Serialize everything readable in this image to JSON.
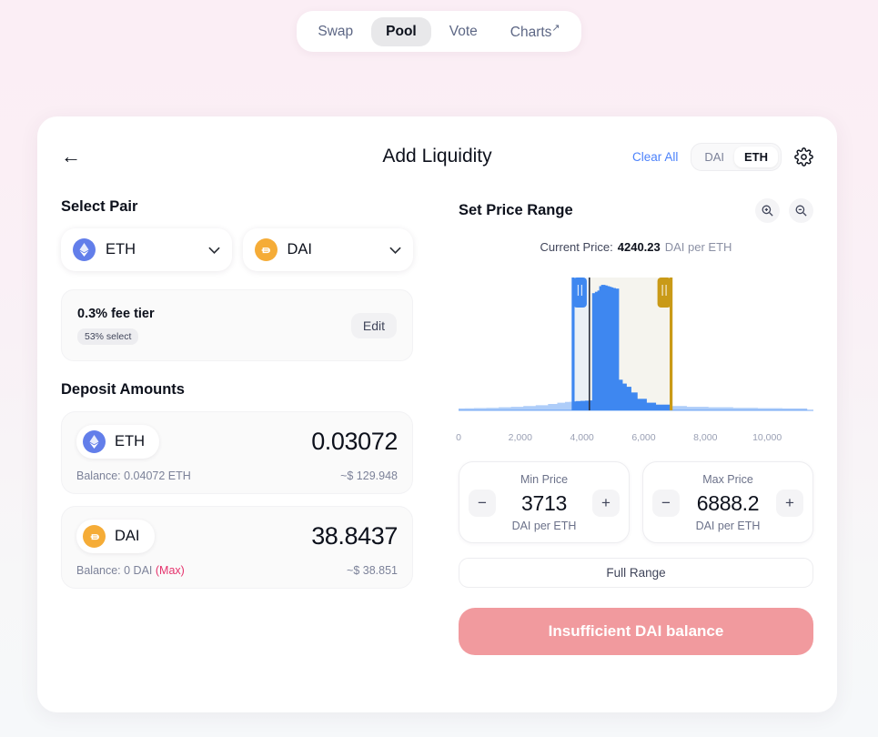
{
  "nav": {
    "items": [
      {
        "label": "Swap",
        "active": false,
        "external": false
      },
      {
        "label": "Pool",
        "active": true,
        "external": false
      },
      {
        "label": "Vote",
        "active": false,
        "external": false
      },
      {
        "label": "Charts",
        "active": false,
        "external": true
      }
    ],
    "external_marker": "↗"
  },
  "header": {
    "back_icon": "←",
    "title": "Add Liquidity",
    "clear_all": "Clear All",
    "toggle": {
      "left": "DAI",
      "right": "ETH",
      "selected": "ETH"
    },
    "settings_icon": "gear-icon"
  },
  "select_pair": {
    "title": "Select Pair",
    "tokens": [
      {
        "symbol": "ETH",
        "icon": "eth-icon",
        "color": "#627eea"
      },
      {
        "symbol": "DAI",
        "icon": "dai-icon",
        "color": "#f5ac37"
      }
    ],
    "chevron": "⌄"
  },
  "fee_tier": {
    "name": "0.3% fee tier",
    "badge": "53% select",
    "edit_label": "Edit"
  },
  "deposit": {
    "title": "Deposit Amounts",
    "rows": [
      {
        "symbol": "ETH",
        "icon": "eth-icon",
        "amount": "0.03072",
        "balance": "Balance: 0.04072 ETH",
        "max_label": "",
        "usd": "~$ 129.948"
      },
      {
        "symbol": "DAI",
        "icon": "dai-icon",
        "amount": "38.8437",
        "balance": "Balance: 0 DAI",
        "max_label": "(Max)",
        "usd": "~$ 38.851"
      }
    ]
  },
  "price_range": {
    "title": "Set Price Range",
    "zoom_in_icon": "zoom-in-icon",
    "zoom_out_icon": "zoom-out-icon",
    "current_price_label": "Current Price:",
    "current_price_value": "4240.23",
    "current_price_unit": "DAI per ETH",
    "min": {
      "label": "Min Price",
      "value": "3713",
      "unit": "DAI per ETH",
      "minus": "−",
      "plus": "+"
    },
    "max": {
      "label": "Max Price",
      "value": "6888.2",
      "unit": "DAI per ETH",
      "minus": "−",
      "plus": "+"
    },
    "full_range_label": "Full Range",
    "cta_label": "Insufficient DAI balance",
    "cta_color": "#f19a9e",
    "handle_left_color": "#3e87f0",
    "handle_right_color": "#c99a17"
  },
  "chart_data": {
    "type": "area",
    "title": "",
    "xlabel": "",
    "ylabel": "",
    "xlim": [
      0,
      11500
    ],
    "ylim": [
      0,
      100
    ],
    "grid": false,
    "legend": "none",
    "tick_labels": [
      "0",
      "2,000",
      "4,000",
      "6,000",
      "8,000",
      "10,000"
    ],
    "ticks": [
      0,
      2000,
      4000,
      6000,
      8000,
      10000
    ],
    "current_price": 4240.23,
    "range_min": 3713,
    "range_max": 6888.2,
    "series_color": "#3e87f0",
    "x": [
      0,
      200,
      500,
      900,
      1300,
      1700,
      2100,
      2500,
      2900,
      3200,
      3450,
      3600,
      3713,
      3800,
      3950,
      4100,
      4240,
      4330,
      4420,
      4500,
      4560,
      4620,
      4700,
      4760,
      4830,
      4900,
      4960,
      5020,
      5100,
      5200,
      5320,
      5450,
      5600,
      5800,
      6100,
      6400,
      6888,
      7400,
      8100,
      8900,
      9700,
      10500,
      11300
    ],
    "y": [
      1.5,
      1.6,
      1.8,
      2.0,
      2.4,
      2.8,
      3.4,
      4.0,
      5.0,
      6.0,
      6.6,
      6.8,
      7.0,
      7.2,
      7.4,
      7.6,
      7.8,
      92.0,
      93.0,
      94.0,
      97.5,
      98.5,
      98.5,
      98.0,
      97.5,
      97.0,
      96.5,
      96.0,
      95.5,
      24.0,
      21.0,
      18.5,
      14.0,
      9.0,
      6.0,
      4.5,
      3.4,
      2.8,
      2.4,
      2.0,
      1.7,
      1.5,
      1.3
    ]
  }
}
